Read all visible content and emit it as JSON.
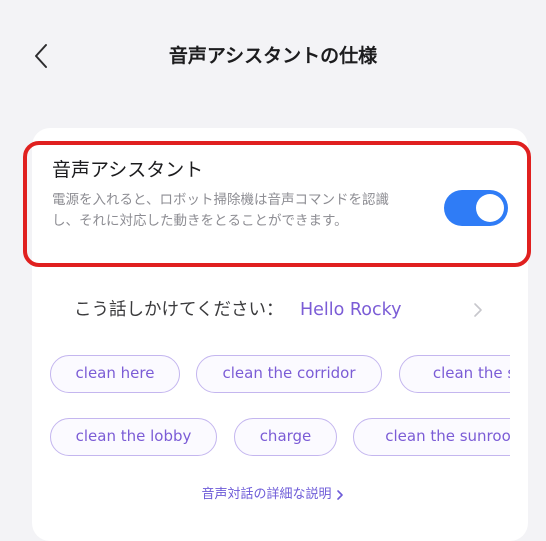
{
  "header": {
    "title": "音声アシスタントの仕様"
  },
  "voice_assistant": {
    "title": "音声アシスタント",
    "description": "電源を入れると、ロボット掃除機は音声コマンドを認識し、それに対応した動きをとることができます。",
    "enabled": true
  },
  "wake_word": {
    "label": "こう話しかけてください：",
    "value": "Hello Rocky"
  },
  "commands": {
    "row1": [
      "clean here",
      "clean the corridor",
      "clean the s"
    ],
    "row2": [
      "clean the lobby",
      "charge",
      "clean the sunroo"
    ]
  },
  "footer": {
    "link_label": "音声対話の詳細な説明"
  },
  "colors": {
    "toggle_on": "#2f7cf6",
    "highlight_border": "#e0201f",
    "chip_text": "#7b5cd6",
    "chip_border": "#c4b6ef"
  }
}
